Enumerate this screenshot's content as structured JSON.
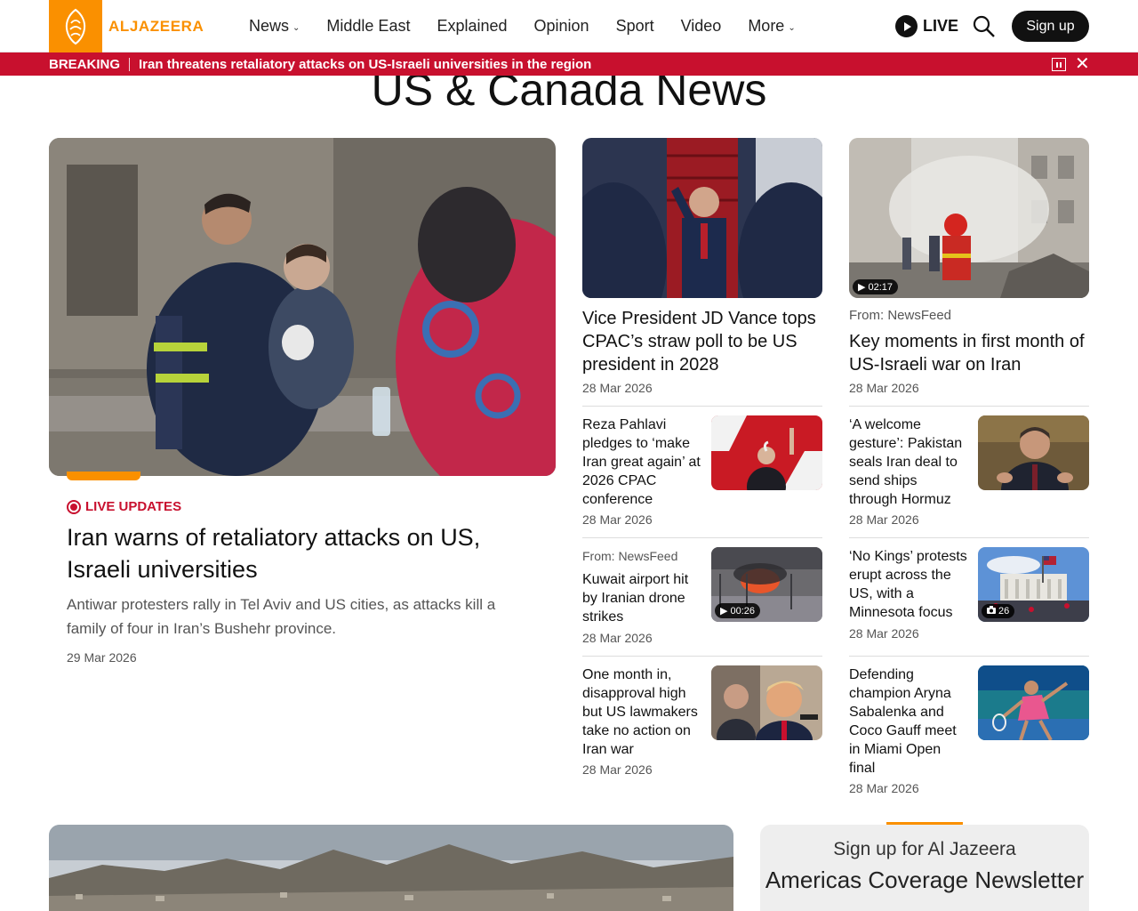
{
  "brand": {
    "name": "ALJAZEERA",
    "accent": "#fa9000",
    "breaking_red": "#c8102e"
  },
  "nav": {
    "items": [
      {
        "label": "News",
        "dropdown": true
      },
      {
        "label": "Middle East",
        "dropdown": false
      },
      {
        "label": "Explained",
        "dropdown": false
      },
      {
        "label": "Opinion",
        "dropdown": false
      },
      {
        "label": "Sport",
        "dropdown": false
      },
      {
        "label": "Video",
        "dropdown": false
      },
      {
        "label": "More",
        "dropdown": true
      }
    ],
    "live_label": "LIVE",
    "signup_label": "Sign up"
  },
  "breaking": {
    "label": "BREAKING",
    "text": "Iran threatens retaliatory attacks on US-Israeli universities in the region"
  },
  "page_title": "US & Canada News",
  "hero": {
    "tag": "LIVE UPDATES",
    "title": "Iran warns of retaliatory attacks on US, Israeli universities",
    "summary": "Antiwar protesters rally in Tel Aviv and US cities, as attacks kill a family of four in Iran’s Bushehr province.",
    "date": "29 Mar 2026"
  },
  "col1": {
    "featured": {
      "title": "Vice President JD Vance tops CPAC’s straw poll to be US president in 2028",
      "date": "28 Mar 2026"
    },
    "items": [
      {
        "title": "Reza Pahlavi pledges to ‘make Iran great again’ at 2026 CPAC conference",
        "date": "28 Mar 2026"
      },
      {
        "from": "From: NewsFeed",
        "title": "Kuwait airport hit by Iranian drone strikes",
        "date": "28 Mar 2026",
        "badge": "00:26"
      },
      {
        "title": "One month in, disapproval high but US lawmakers take no action on Iran war",
        "date": "28 Mar 2026"
      }
    ]
  },
  "col2": {
    "featured": {
      "from": "From: NewsFeed",
      "title": "Key moments in first month of US-Israeli war on Iran",
      "date": "28 Mar 2026",
      "badge": "02:17"
    },
    "items": [
      {
        "title": "‘A welcome gesture’: Pakistan seals Iran deal to send ships through Hormuz",
        "date": "28 Mar 2026"
      },
      {
        "title": "‘No Kings’ protests erupt across the US, with a Minnesota focus",
        "date": "28 Mar 2026",
        "badge": "26"
      },
      {
        "title": "Defending champion Aryna Sabalenka and Coco Gauff meet in Miami Open final",
        "date": "28 Mar 2026"
      }
    ]
  },
  "newsletter": {
    "line1": "Sign up for Al Jazeera",
    "line2": "Americas Coverage Newsletter"
  }
}
